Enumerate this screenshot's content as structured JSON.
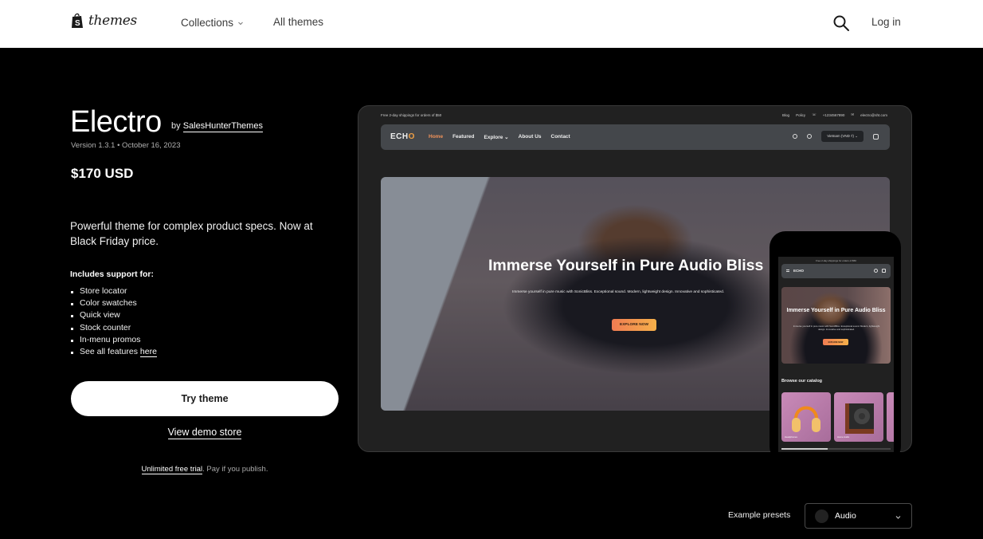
{
  "header": {
    "logo_text": "themes",
    "nav": [
      {
        "label": "Collections",
        "has_dropdown": true
      },
      {
        "label": "All themes",
        "has_dropdown": false
      }
    ],
    "search_icon": "search-icon",
    "login_label": "Log in"
  },
  "theme": {
    "name": "Electro",
    "by_prefix": "by",
    "author": "SalesHunterThemes",
    "version_line": "Version 1.3.1 • October 16, 2023",
    "price": "$170 USD",
    "description": "Powerful theme for complex product specs. Now at Black Friday price.",
    "includes_title": "Includes support for:",
    "features": [
      "Store locator",
      "Color swatches",
      "Quick view",
      "Stock counter",
      "In-menu promos"
    ],
    "features_more_prefix": "See all features ",
    "features_more_link": "here",
    "try_button": "Try theme",
    "demo_link": "View demo store",
    "trial_link": "Unlimited free trial",
    "trial_suffix": ". Pay if you publish."
  },
  "preview": {
    "announcement": "Free 2-day shippings for orders of $50",
    "top_links": [
      "Blog",
      "Policy",
      "+1234567890",
      "electro@sht.com"
    ],
    "logo": "ECH",
    "logo_accent": "O",
    "menu": [
      {
        "label": "Home",
        "active": true
      },
      {
        "label": "Featured",
        "active": false
      },
      {
        "label": "Explore",
        "active": false,
        "dropdown": true
      },
      {
        "label": "About Us",
        "active": false
      },
      {
        "label": "Contact",
        "active": false
      }
    ],
    "currency": "Vietnam (VND ₫)",
    "hero_title": "Immerse Yourself in Pure Audio Bliss",
    "hero_subtitle": "Immerse yourself in pure music with SonicBliss. Exceptional sound. Modern, lightweight design. Innovative and sophisticated.",
    "hero_button": "EXPLORE NOW",
    "accent_color": "#f2935a"
  },
  "mobile_preview": {
    "announcement": "Free 2-day shippings for orders of $50",
    "logo": "ECHO",
    "hero_title": "Immerse Yourself in Pure Audio Bliss",
    "hero_subtitle": "Immerse yourself in pure music with SonicBliss. Exceptional sound. Modern, lightweight design. Innovative and sophisticated.",
    "hero_button": "EXPLORE NOW",
    "catalog_title": "Browse our catalog",
    "catalog_items": [
      "Headphones",
      "Home Audio"
    ]
  },
  "presets": {
    "label": "Example presets",
    "selected": "Audio"
  }
}
